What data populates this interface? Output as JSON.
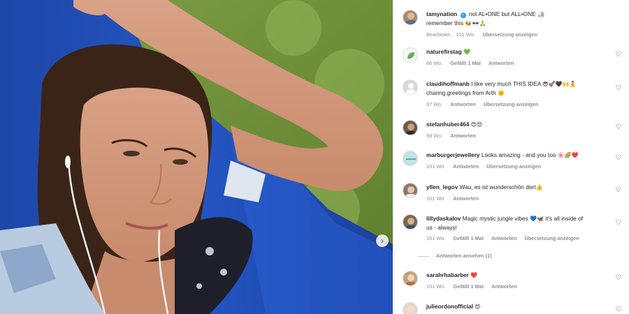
{
  "post": {
    "author": "tamynation",
    "caption_line1": "not AL•ONE but ALL•ONE",
    "caption_line2": "remember this",
    "caption_emoji1": "🏕",
    "caption_emoji2": "🐝🕶🙏",
    "meta_edited": "Bearbeitet",
    "meta_age": "101 Wo.",
    "meta_translate": "Übersetzung anzeigen"
  },
  "comments": [
    {
      "user": "naturefirstag",
      "text": "",
      "emoji": "💚",
      "age": "86 Wo.",
      "likes": "Gefällt 1 Mal",
      "reply": "Antworten",
      "translate": ""
    },
    {
      "user": "claudihoffmanb",
      "text": "I like very much THIS IDEA",
      "emoji": "😎🚀🖤🙌🧘",
      "text2": "charing greetings from Arth",
      "emoji2": "🌞",
      "age": "97 Wo.",
      "likes": "",
      "reply": "Antworten",
      "translate": "Übersetzung anzeigen"
    },
    {
      "user": "stefanhuber464",
      "text": "",
      "emoji": "😍😍",
      "age": "99 Wo.",
      "likes": "",
      "reply": "Antworten",
      "translate": ""
    },
    {
      "user": "marburgerjewellery",
      "text": "Looks amazing - and you too",
      "emoji": "🌸🌈❤️",
      "age": "101 Wo.",
      "likes": "",
      "reply": "Antworten",
      "translate": "Übersetzung anzeigen"
    },
    {
      "user": "yllen_legov",
      "text": "Wau, es ist wunderschön dort",
      "emoji": "👍",
      "age": "101 Wo.",
      "likes": "",
      "reply": "Antworten",
      "translate": ""
    },
    {
      "user": "lillydaskalov",
      "text": "Magic mystic jungle vibes",
      "emoji": "💙🦋",
      "text_after": "it's all inside of",
      "text2": "us - always!",
      "age": "101 Wo.",
      "likes": "Gefällt 1 Mal",
      "reply": "Antworten",
      "translate": "Übersetzung anzeigen",
      "view_replies": "Antworten ansehen (1)"
    },
    {
      "user": "sarahrhabarber",
      "text": "",
      "emoji": "❤️",
      "age": "101 Wo.",
      "likes": "Gefällt 1 Mal",
      "reply": "Antworten",
      "translate": ""
    },
    {
      "user": "julieordonofficial",
      "text": "",
      "emoji": "😍",
      "age": "",
      "likes": "",
      "reply": "",
      "translate": ""
    }
  ],
  "icons": {
    "like": "heart-outline-icon",
    "next": "chevron-right-icon",
    "verified": "verified-badge-icon"
  },
  "glyphs": {
    "heart": "♡",
    "next": "›",
    "check": "✓"
  }
}
